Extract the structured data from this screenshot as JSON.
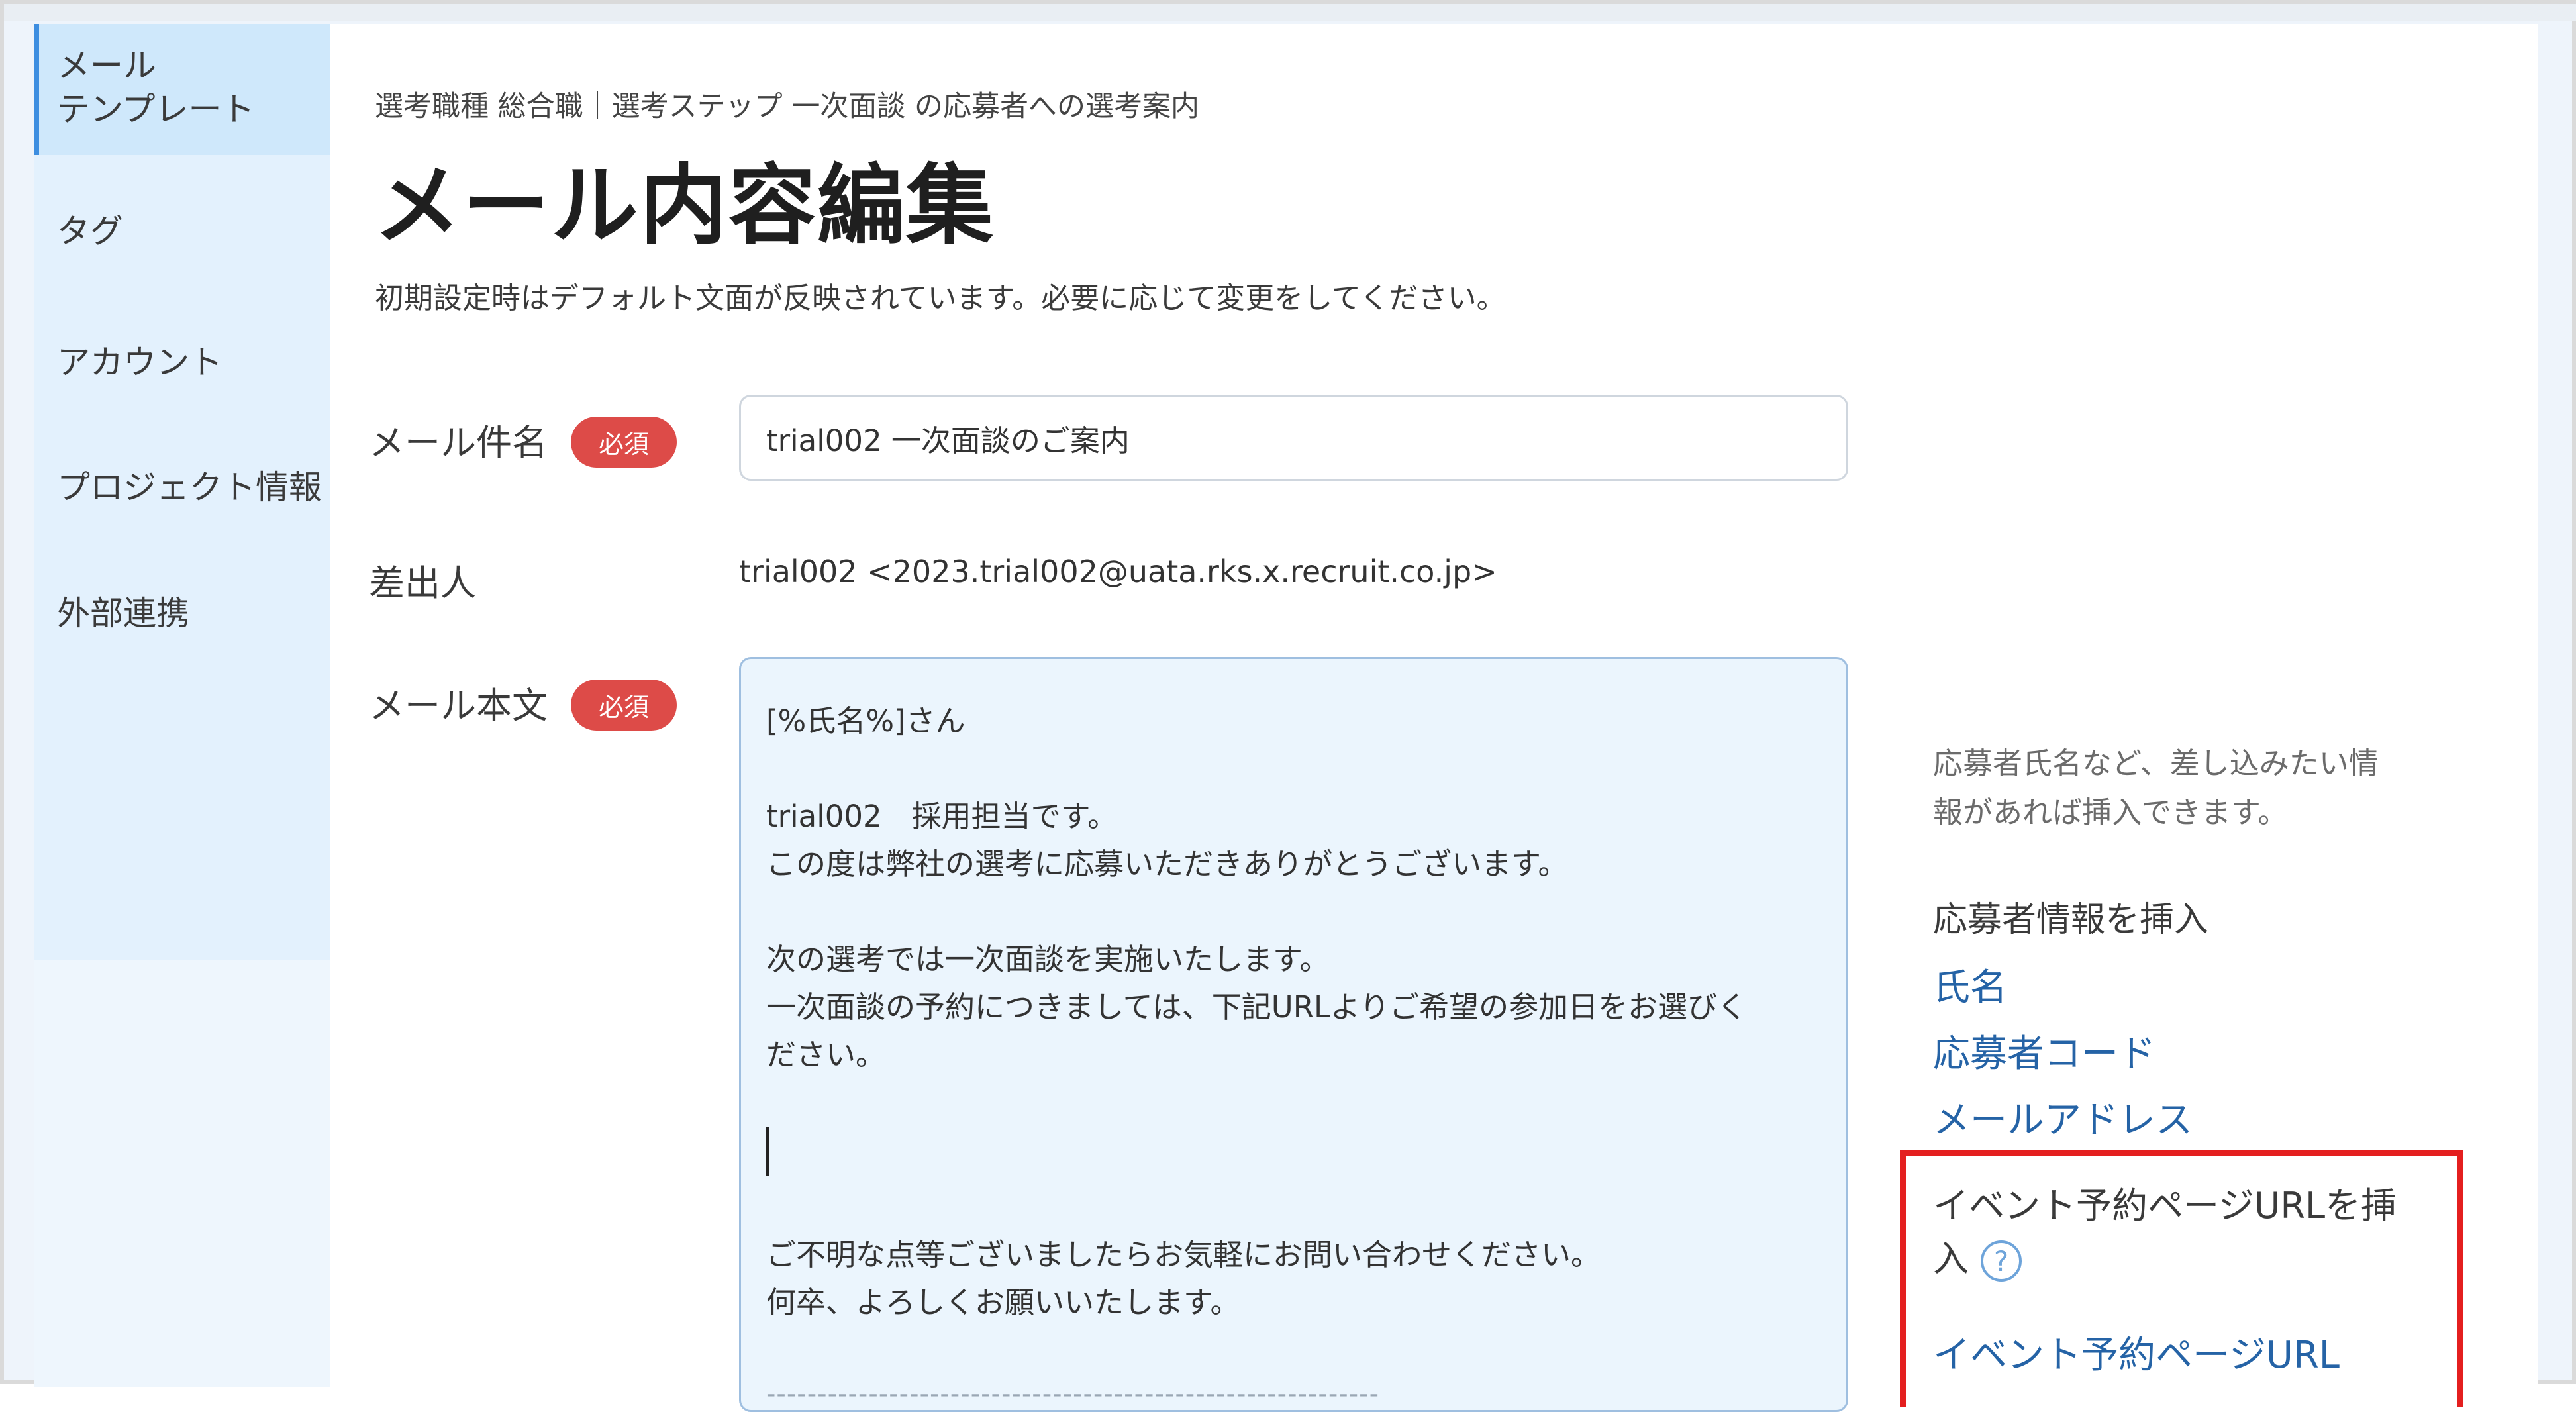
{
  "sidebar": {
    "items": [
      {
        "label_line1": "メール",
        "label_line2": "テンプレート"
      },
      {
        "label": "タグ"
      },
      {
        "label": "アカウント"
      },
      {
        "label": "プロジェクト情報"
      },
      {
        "label": "外部連携"
      }
    ]
  },
  "header": {
    "breadcrumb": "選考職種 総合職｜選考ステップ 一次面談 の応募者への選考案内",
    "title": "メール内容編集",
    "description": "初期設定時はデフォルト文面が反映されています。必要に応じて変更をしてください。"
  },
  "form": {
    "subject": {
      "label": "メール件名",
      "required_badge": "必須",
      "value": "trial002 一次面談のご案内"
    },
    "sender": {
      "label": "差出人",
      "value": "trial002 <2023.trial002@uata.rks.x.recruit.co.jp>"
    },
    "body": {
      "label": "メール本文",
      "required_badge": "必須",
      "lines": [
        "[%氏名%]さん",
        "",
        "trial002　採用担当です。",
        "この度は弊社の選考に応募いただきありがとうございます。",
        "",
        "次の選考では一次面談を実施いたします。",
        "一次面談の予約につきましては、下記URLよりご希望の参加日をお選びく",
        "ださい。",
        "",
        "",
        "",
        "ご不明な点等ございましたらお気軽にお問い合わせください。",
        "何卒、よろしくお願いいたします。",
        "",
        "------------------------------------------------------------"
      ]
    }
  },
  "insert_panel": {
    "hint_line1": "応募者氏名など、差し込みたい情",
    "hint_line2": "報があれば挿入できます。",
    "applicant_heading": "応募者情報を挿入",
    "applicant_links": [
      "氏名",
      "応募者コード",
      "メールアドレス"
    ],
    "event_heading_line1": "イベント予約ページURLを挿",
    "event_heading_line2": "入",
    "help_icon": "?",
    "event_link": "イベント予約ページURL"
  },
  "colors": {
    "required_badge": "#dd4b48",
    "link": "#2563a6",
    "highlight_box": "#e41f1f",
    "sidebar_active": "#cfe8fb",
    "editor_bg": "#ebf5fd"
  }
}
